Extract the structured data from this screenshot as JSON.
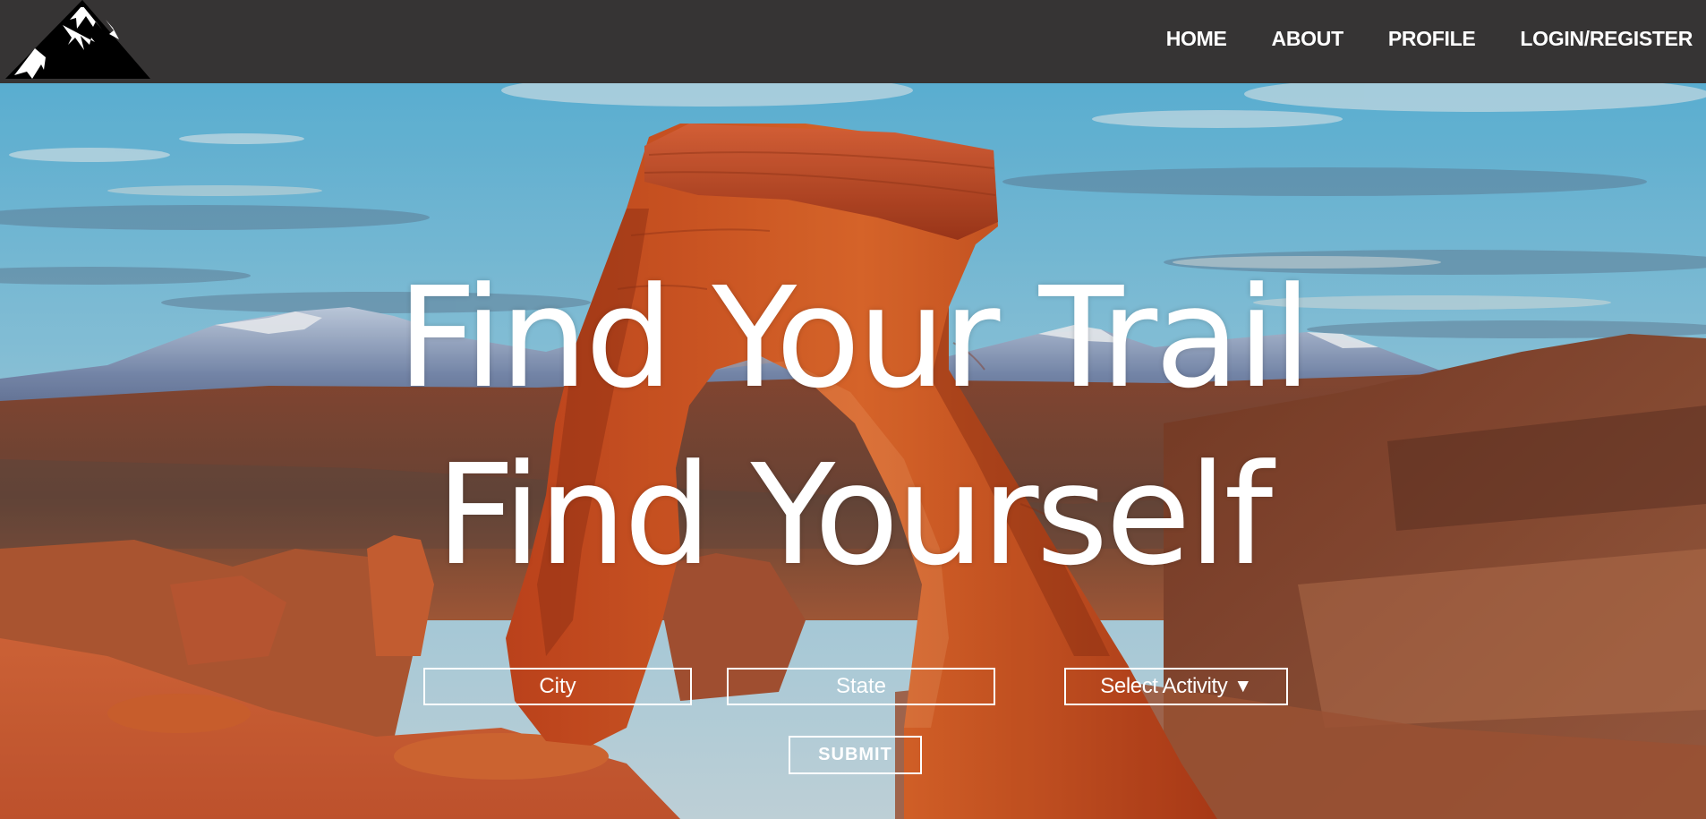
{
  "nav": {
    "logo_icon": "mountain-logo-icon",
    "items": [
      {
        "label": "HOME"
      },
      {
        "label": "ABOUT"
      },
      {
        "label": "PROFILE"
      },
      {
        "label": "LOGIN/REGISTER"
      }
    ]
  },
  "hero": {
    "background": "delicate-arch-landscape-photo",
    "title_line_1": "Find Your Trail",
    "title_line_2": "Find Yourself"
  },
  "search": {
    "city_placeholder": "City",
    "state_placeholder": "State",
    "activity_label": "Select Activity",
    "activity_caret": "▼",
    "submit_label": "SUBMIT"
  },
  "colors": {
    "navbar": "#363434",
    "text": "#ffffff"
  }
}
